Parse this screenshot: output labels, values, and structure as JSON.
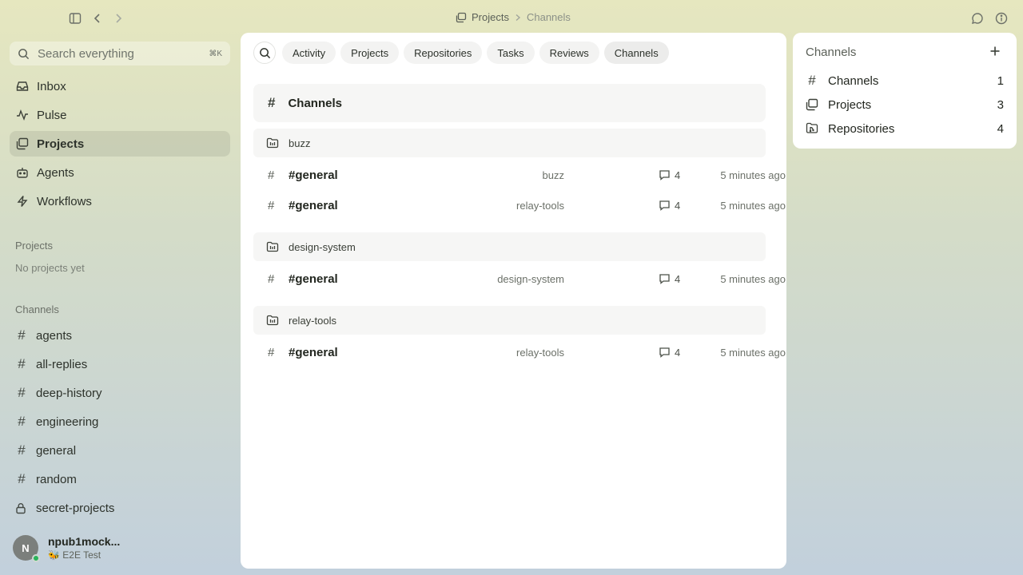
{
  "topbar": {
    "breadcrumb": [
      "Projects",
      "Channels"
    ]
  },
  "sidebar": {
    "search": {
      "placeholder": "Search everything",
      "shortcut": "⌘K"
    },
    "nav": [
      {
        "label": "Inbox",
        "icon": "inbox-icon"
      },
      {
        "label": "Pulse",
        "icon": "pulse-icon"
      },
      {
        "label": "Projects",
        "icon": "projects-icon",
        "active": true
      },
      {
        "label": "Agents",
        "icon": "bot-icon"
      },
      {
        "label": "Workflows",
        "icon": "bolt-icon"
      }
    ],
    "projects_label": "Projects",
    "no_projects": "No projects yet",
    "channels_label": "Channels",
    "channels": [
      {
        "label": "agents",
        "icon": "hash-icon"
      },
      {
        "label": "all-replies",
        "icon": "hash-icon"
      },
      {
        "label": "deep-history",
        "icon": "hash-icon"
      },
      {
        "label": "engineering",
        "icon": "hash-icon"
      },
      {
        "label": "general",
        "icon": "hash-icon"
      },
      {
        "label": "random",
        "icon": "hash-icon"
      },
      {
        "label": "secret-projects",
        "icon": "lock-icon"
      }
    ],
    "user": {
      "initial": "N",
      "name": "npub1mock...",
      "status": "🐝 E2E Test"
    }
  },
  "main": {
    "filters": [
      "Activity",
      "Projects",
      "Repositories",
      "Tasks",
      "Reviews",
      "Channels"
    ],
    "active_filter": "Channels",
    "title": "Channels",
    "groups": [
      {
        "name": "buzz",
        "rows": [
          {
            "name": "#general",
            "project": "buzz",
            "count": "4",
            "time": "5 minutes ago"
          },
          {
            "name": "#general",
            "project": "relay-tools",
            "count": "4",
            "time": "5 minutes ago"
          }
        ]
      },
      {
        "name": "design-system",
        "rows": [
          {
            "name": "#general",
            "project": "design-system",
            "count": "4",
            "time": "5 minutes ago"
          }
        ]
      },
      {
        "name": "relay-tools",
        "rows": [
          {
            "name": "#general",
            "project": "relay-tools",
            "count": "4",
            "time": "5 minutes ago"
          }
        ]
      }
    ]
  },
  "right_panel": {
    "title": "Channels",
    "stats": [
      {
        "label": "Channels",
        "value": "1",
        "icon": "hash-icon"
      },
      {
        "label": "Projects",
        "value": "3",
        "icon": "projects-icon"
      },
      {
        "label": "Repositories",
        "value": "4",
        "icon": "repo-icon"
      }
    ]
  }
}
